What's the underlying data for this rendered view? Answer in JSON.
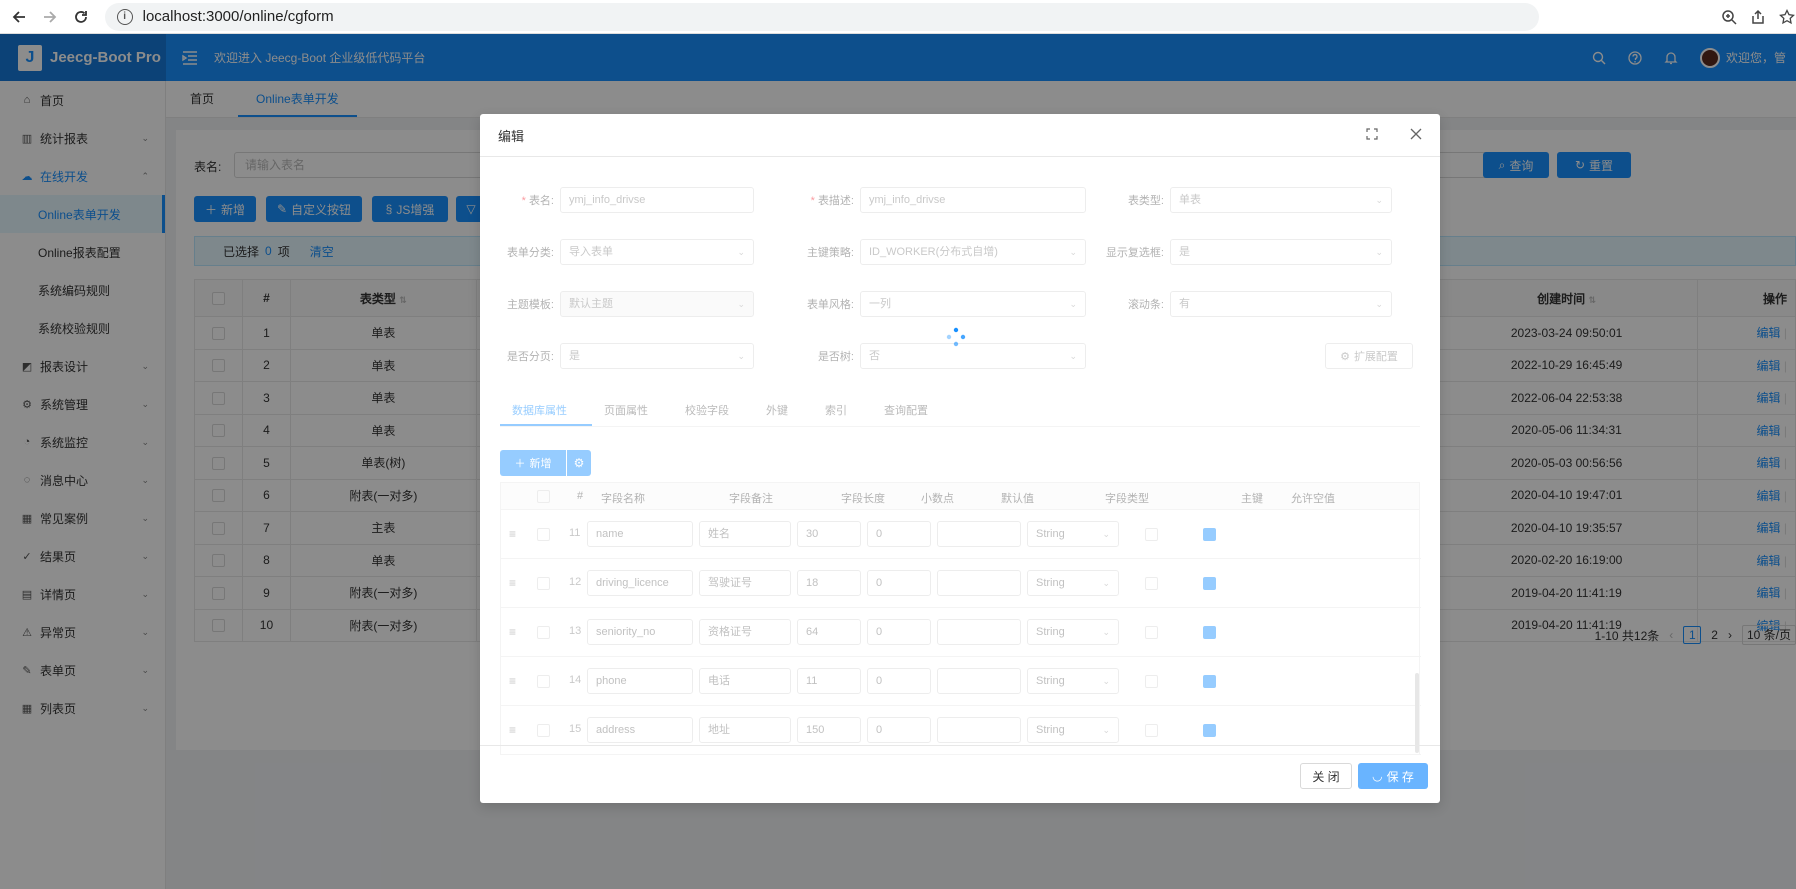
{
  "browser": {
    "url": "localhost:3000/online/cgform"
  },
  "header": {
    "logo": "Jeecg-Boot Pro",
    "logo_letter": "J",
    "welcome": "欢迎进入 Jeecg-Boot 企业级低代码平台",
    "user_greeting": "欢迎您，管"
  },
  "sidebar": {
    "items": [
      {
        "label": "首页",
        "icon": "home-icon"
      },
      {
        "label": "统计报表",
        "icon": "bar-chart-icon"
      },
      {
        "label": "在线开发",
        "icon": "cloud-icon"
      },
      {
        "label": "Online表单开发"
      },
      {
        "label": "Online报表配置"
      },
      {
        "label": "系统编码规则"
      },
      {
        "label": "系统校验规则"
      },
      {
        "label": "报表设计",
        "icon": "area-chart-icon"
      },
      {
        "label": "系统管理",
        "icon": "setting-icon"
      },
      {
        "label": "系统监控",
        "icon": "dashboard-icon"
      },
      {
        "label": "消息中心",
        "icon": "message-icon"
      },
      {
        "label": "常见案例",
        "icon": "appstore-icon"
      },
      {
        "label": "结果页",
        "icon": "check-circle-icon"
      },
      {
        "label": "详情页",
        "icon": "profile-icon"
      },
      {
        "label": "异常页",
        "icon": "warning-icon"
      },
      {
        "label": "表单页",
        "icon": "form-icon"
      },
      {
        "label": "列表页",
        "icon": "table-icon"
      }
    ]
  },
  "tabs": [
    "首页",
    "Online表单开发"
  ],
  "query": {
    "label": "表名:",
    "placeholder": "请输入表名",
    "search": "查询",
    "reset": "重置"
  },
  "toolbar": {
    "add": "新增",
    "custom_button": "自定义按钮",
    "js": "JS增强"
  },
  "selection": {
    "prefix": "已选择",
    "count": "0",
    "suffix": "项",
    "clear": "清空"
  },
  "table": {
    "headers": [
      "#",
      "表类型",
      "创建时间",
      "操作"
    ],
    "rows": [
      {
        "no": "1",
        "type": "单表",
        "time": "2023-03-24 09:50:01",
        "op": "编辑"
      },
      {
        "no": "2",
        "type": "单表",
        "time": "2022-10-29 16:45:49",
        "op": "编辑"
      },
      {
        "no": "3",
        "type": "单表",
        "time": "2022-06-04 22:53:38",
        "op": "编辑"
      },
      {
        "no": "4",
        "type": "单表",
        "time": "2020-05-06 11:34:31",
        "op": "编辑"
      },
      {
        "no": "5",
        "type": "单表(树)",
        "time": "2020-05-03 00:56:56",
        "op": "编辑"
      },
      {
        "no": "6",
        "type": "附表(一对多)",
        "time": "2020-04-10 19:47:01",
        "op": "编辑"
      },
      {
        "no": "7",
        "type": "主表",
        "time": "2020-04-10 19:35:57",
        "op": "编辑"
      },
      {
        "no": "8",
        "type": "单表",
        "time": "2020-02-20 16:19:00",
        "op": "编辑"
      },
      {
        "no": "9",
        "type": "附表(一对多)",
        "time": "2019-04-20 11:41:19",
        "op": "编辑"
      },
      {
        "no": "10",
        "type": "附表(一对多)",
        "time": "2019-04-20 11:41:19",
        "op": "编辑"
      }
    ]
  },
  "pager": {
    "total": "1-10 共12条",
    "page1": "1",
    "page2": "2",
    "size": "10 条/页"
  },
  "modal": {
    "title": "编辑",
    "form": {
      "table_name_label": "表名:",
      "table_name": "ymj_info_drivse",
      "table_desc_label": "表描述:",
      "table_desc": "ymj_info_drivse",
      "table_type_label": "表类型:",
      "table_type": "单表",
      "form_category_label": "表单分类:",
      "form_category": "导入表单",
      "pk_strategy_label": "主键策略:",
      "pk_strategy": "ID_WORKER(分布式自增)",
      "show_checkbox_label": "显示复选框:",
      "show_checkbox": "是",
      "theme_label": "主题模板:",
      "theme": "默认主题",
      "form_style_label": "表单风格:",
      "form_style": "一列",
      "scrollbar_label": "滚动条:",
      "scrollbar": "有",
      "paging_label": "是否分页:",
      "paging": "是",
      "tree_label": "是否树:",
      "tree": "否",
      "ext_config": "扩展配置"
    },
    "subtabs": [
      "数据库属性",
      "页面属性",
      "校验字段",
      "外键",
      "索引",
      "查询配置"
    ],
    "add_button": "新增",
    "grid_headers": [
      "#",
      "字段名称",
      "字段备注",
      "字段长度",
      "小数点",
      "默认值",
      "字段类型",
      "主键",
      "允许空值"
    ],
    "fields": [
      {
        "no": "11",
        "name": "name",
        "remark": "姓名",
        "length": "30",
        "decimal": "0",
        "type": "String"
      },
      {
        "no": "12",
        "name": "driving_licence",
        "remark": "驾驶证号",
        "length": "18",
        "decimal": "0",
        "type": "String"
      },
      {
        "no": "13",
        "name": "seniority_no",
        "remark": "资格证号",
        "length": "64",
        "decimal": "0",
        "type": "String"
      },
      {
        "no": "14",
        "name": "phone",
        "remark": "电话",
        "length": "11",
        "decimal": "0",
        "type": "String"
      },
      {
        "no": "15",
        "name": "address",
        "remark": "地址",
        "length": "150",
        "decimal": "0",
        "type": "String"
      }
    ],
    "close": "关 闭",
    "save": "保 存"
  }
}
